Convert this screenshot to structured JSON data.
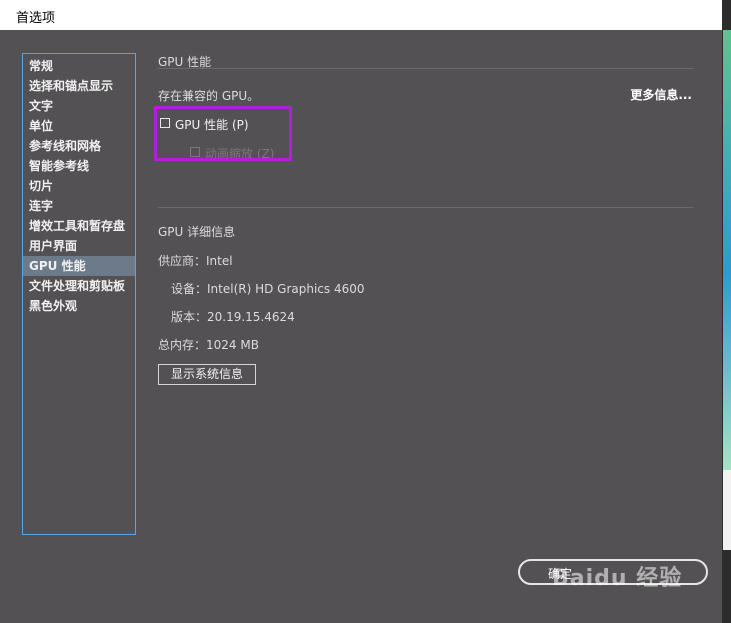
{
  "dialog": {
    "title": "首选项"
  },
  "sidebar": {
    "items": [
      {
        "label": "常规"
      },
      {
        "label": "选择和锚点显示"
      },
      {
        "label": "文字"
      },
      {
        "label": "单位"
      },
      {
        "label": "参考线和网格"
      },
      {
        "label": "智能参考线"
      },
      {
        "label": "切片"
      },
      {
        "label": "连字"
      },
      {
        "label": "增效工具和暂存盘"
      },
      {
        "label": "用户界面"
      },
      {
        "label": "GPU 性能",
        "selected": true
      },
      {
        "label": "文件处理和剪贴板"
      },
      {
        "label": "黑色外观"
      }
    ]
  },
  "gpu": {
    "section_title": "GPU 性能",
    "compatible_text": "存在兼容的 GPU。",
    "more_info_link": "更多信息...",
    "gpu_performance_checkbox": {
      "label": "GPU 性能 (P)",
      "checked": false
    },
    "animated_zoom_checkbox": {
      "label": "动画缩放 (Z)",
      "checked": false,
      "disabled": true
    },
    "details_title": "GPU 详细信息",
    "vendor": "供应商：Intel",
    "device": "设备：Intel(R) HD Graphics 4600",
    "version": "版本：20.19.15.4624",
    "total_memory": "总内存：1024 MB",
    "show_system_info_button": "显示系统信息"
  },
  "footer": {
    "ok_button": "确定"
  },
  "watermark": {
    "text": "Baidu 经验"
  },
  "colors": {
    "highlight": "#b31fd8",
    "sidebar_border": "#5aa4e0",
    "dialog_bg": "#535153"
  }
}
